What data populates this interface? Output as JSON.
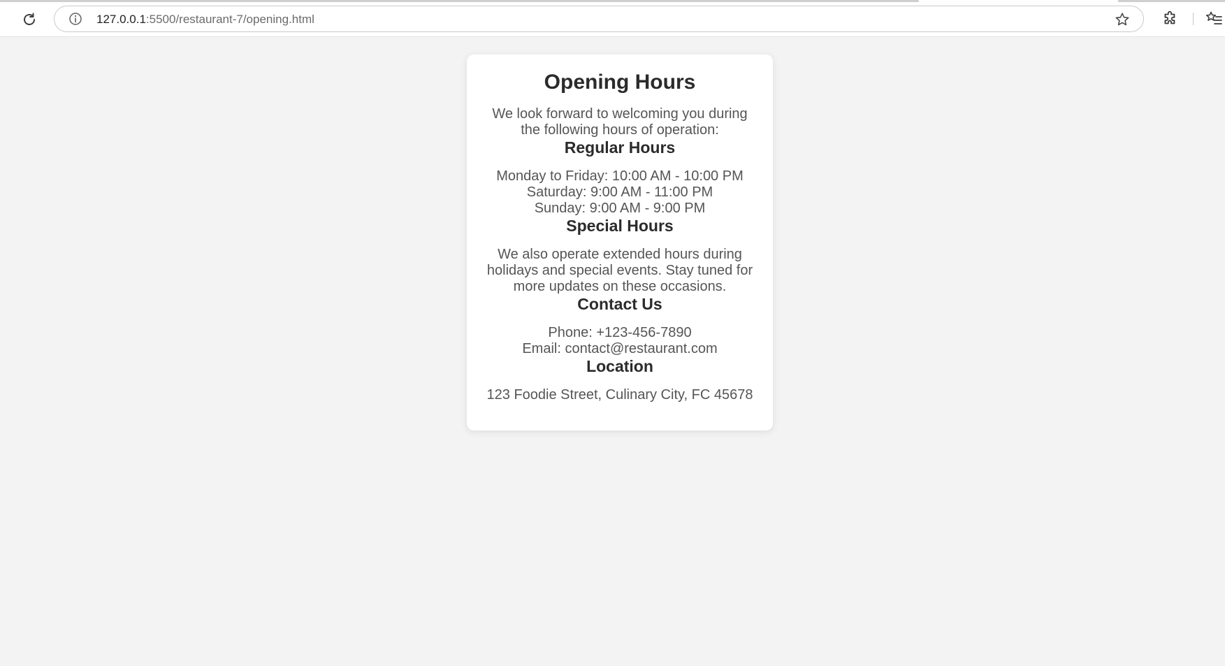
{
  "browser": {
    "url_host": "127.0.0.1",
    "url_path": ":5500/restaurant-7/opening.html"
  },
  "card": {
    "title": "Opening Hours",
    "intro": "We look forward to welcoming you during the following hours of operation:",
    "regular": {
      "heading": "Regular Hours",
      "lines": [
        "Monday to Friday: 10:00 AM - 10:00 PM",
        "Saturday: 9:00 AM - 11:00 PM",
        "Sunday: 9:00 AM - 9:00 PM"
      ]
    },
    "special": {
      "heading": "Special Hours",
      "text": "We also operate extended hours during holidays and special events. Stay tuned for more updates on these occasions."
    },
    "contact": {
      "heading": "Contact Us",
      "phone": "Phone: +123-456-7890",
      "email": "Email: contact@restaurant.com"
    },
    "location": {
      "heading": "Location",
      "address": "123 Foodie Street, Culinary City, FC 45678"
    }
  }
}
